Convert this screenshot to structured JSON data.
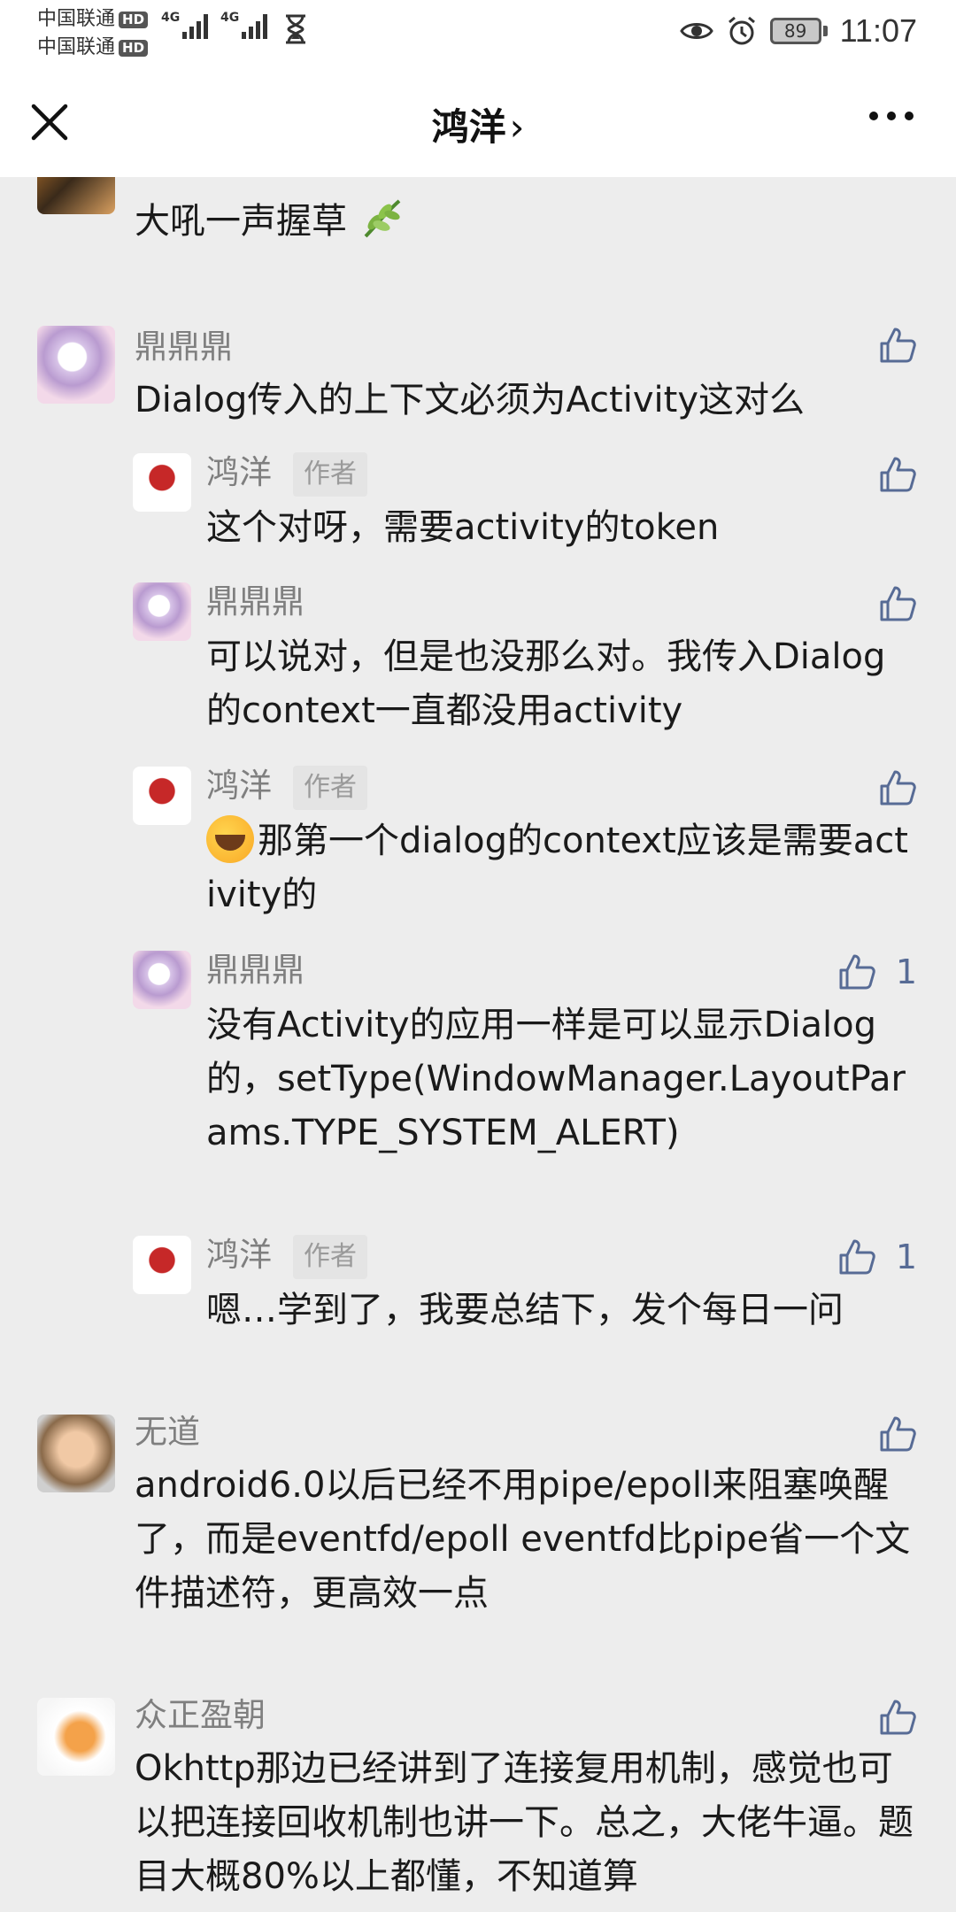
{
  "status_bar": {
    "carrier1": "中国联通",
    "carrier2": "中国联通",
    "hd": "HD",
    "network": "4G",
    "battery": "89",
    "time": "11:07"
  },
  "nav": {
    "title": "鸿洋",
    "chevron": "›"
  },
  "comments": [
    {
      "id": "c0",
      "name": "",
      "text": "大吼一声握草",
      "likes": ""
    },
    {
      "id": "c1",
      "name": "鼎鼎鼎",
      "text": "Dialog传入的上下文必须为Activity这对么",
      "likes": "",
      "replies": [
        {
          "name": "鸿洋",
          "tag": "作者",
          "text": "这个对呀，需要activity的token",
          "likes": ""
        },
        {
          "name": "鼎鼎鼎",
          "tag": "",
          "text": "可以说对，但是也没那么对。我传入Dialog的context一直都没用activity",
          "likes": ""
        },
        {
          "name": "鸿洋",
          "tag": "作者",
          "text": "那第一个dialog的context应该是需要activity的",
          "likes": ""
        },
        {
          "name": "鼎鼎鼎",
          "tag": "",
          "text": "没有Activity的应用一样是可以显示Dialog的，setType(WindowManager.LayoutParams.TYPE_SYSTEM_ALERT)",
          "likes": "1"
        },
        {
          "name": "鸿洋",
          "tag": "作者",
          "text": "嗯…学到了，我要总结下，发个每日一问",
          "likes": "1"
        }
      ]
    },
    {
      "id": "c2",
      "name": "无道",
      "text": "android6.0以后已经不用pipe/epoll来阻塞唤醒了，而是eventfd/epoll eventfd比pipe省一个文件描述符，更高效一点",
      "likes": ""
    },
    {
      "id": "c3",
      "name": "众正盈朝",
      "text": "Okhttp那边已经讲到了连接复用机制，感觉也可以把连接回收机制也讲一下。总之，大佬牛逼。题目大概80%以上都懂，不知道算",
      "likes": ""
    }
  ],
  "colors": {
    "accent": "#576b95",
    "background": "#ededed"
  }
}
